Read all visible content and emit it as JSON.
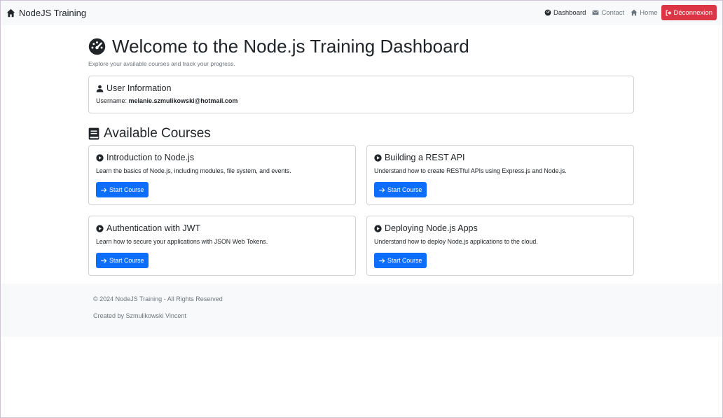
{
  "navbar": {
    "brand": "NodeJS Training",
    "brand_icon": "home-icon",
    "links": [
      {
        "label": "Dashboard",
        "icon": "dashboard-gauge-icon",
        "active": true
      },
      {
        "label": "Contact",
        "icon": "envelope-icon",
        "active": false
      },
      {
        "label": "Home",
        "icon": "home-icon",
        "active": false
      }
    ],
    "logout_label": "Déconnexion"
  },
  "main": {
    "title": "Welcome to the Node.js Training Dashboard",
    "subtitle": "Explore your available courses and track your progress."
  },
  "user": {
    "heading": "User Information",
    "username_label": "Username:",
    "username": "melanie.szmulikowski@hotmail.com"
  },
  "courses": {
    "heading": "Available Courses",
    "button_label": "Start Course",
    "items": [
      {
        "title": "Introduction to Node.js",
        "description": "Learn the basics of Node.js, including modules, file system, and events."
      },
      {
        "title": "Building a REST API",
        "description": "Understand how to create RESTful APIs using Express.js and Node.js."
      },
      {
        "title": "Authentication with JWT",
        "description": "Learn how to secure your applications with JSON Web Tokens."
      },
      {
        "title": "Deploying Node.js Apps",
        "description": "Understand how to deploy Node.js applications to the cloud."
      }
    ]
  },
  "footer": {
    "copyright": "© 2024 NodeJS Training - All Rights Reserved",
    "credit": "Created by Szmulikowski Vincent"
  },
  "colors": {
    "primary": "#0d6efd",
    "danger": "#dc3545",
    "navbar_bg": "#f8f9fa",
    "muted": "#6c757d"
  }
}
